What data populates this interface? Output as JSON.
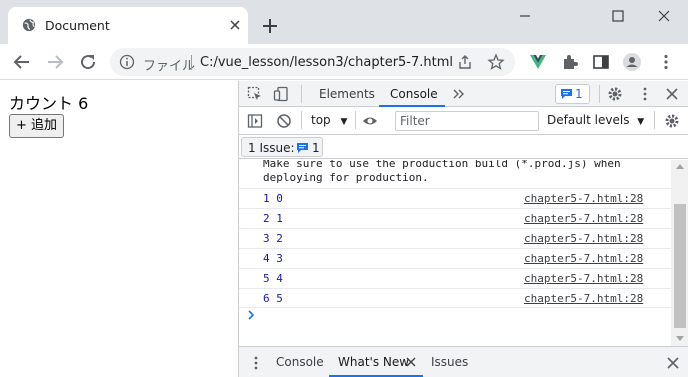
{
  "browser": {
    "tab_title": "Document",
    "url_scheme_label": "ファイル",
    "url": "C:/vue_lesson/lesson3/chapter5-7.html",
    "icons": [
      "globe-icon",
      "close-icon",
      "plus-icon",
      "minimize-icon",
      "restore-icon",
      "close-window-icon",
      "back-icon",
      "forward-icon",
      "reload-icon",
      "info-icon",
      "share-icon",
      "star-icon",
      "vue-devtools-icon",
      "extensions-icon",
      "side-panel-icon",
      "profile-icon",
      "menu-icon"
    ],
    "colors": {
      "vue_green": "#41b883",
      "tabstrip_bg": "#dee1e6"
    }
  },
  "page": {
    "count_text": "カウント 6",
    "add_button_label": "+ 追加"
  },
  "devtools": {
    "tabs": [
      "Elements",
      "Console"
    ],
    "active_tab": "Console",
    "issues_badge_count": "1",
    "context": "top",
    "filter_placeholder": "Filter",
    "levels": "Default levels",
    "issue_chip_label": "1 Issue:",
    "issue_chip_count": "1",
    "warning_text": "Make sure to use the production build (*.prod.js) when\ndeploying for production.",
    "logs": [
      {
        "message": "1 0",
        "source": "chapter5-7.html:28"
      },
      {
        "message": "2 1",
        "source": "chapter5-7.html:28"
      },
      {
        "message": "3 2",
        "source": "chapter5-7.html:28"
      },
      {
        "message": "4 3",
        "source": "chapter5-7.html:28"
      },
      {
        "message": "5 4",
        "source": "chapter5-7.html:28"
      },
      {
        "message": "6 5",
        "source": "chapter5-7.html:28"
      }
    ],
    "drawer_tabs": [
      "Console",
      "What's New",
      "Issues"
    ],
    "drawer_active_tab": "What's New"
  }
}
